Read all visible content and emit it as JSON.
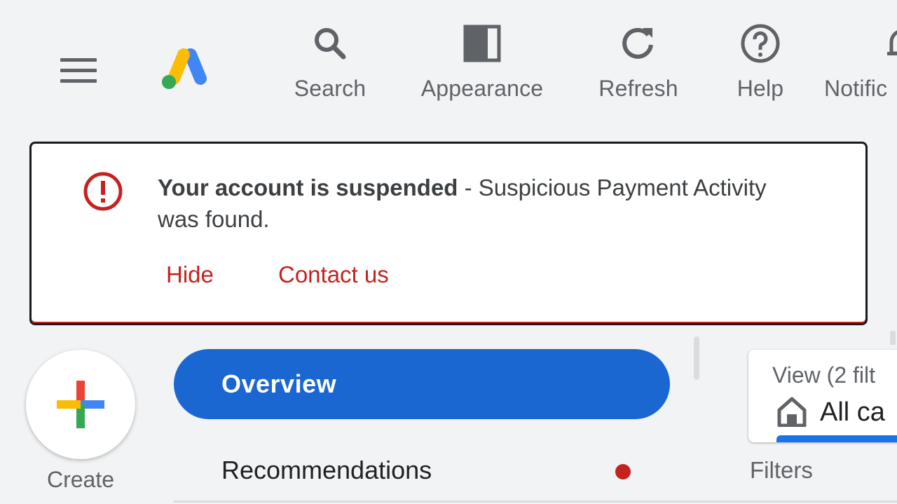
{
  "header": {
    "menu_icon": "hamburger-icon",
    "logo_icon": "google-ads-logo",
    "tools": [
      {
        "label": "Search",
        "icon": "search-icon"
      },
      {
        "label": "Appearance",
        "icon": "appearance-icon"
      },
      {
        "label": "Refresh",
        "icon": "refresh-icon"
      },
      {
        "label": "Help",
        "icon": "help-icon"
      },
      {
        "label": "Notific",
        "icon": "bell-icon"
      }
    ]
  },
  "alert": {
    "icon": "error-icon",
    "title": "Your account is suspended",
    "message": " - Suspicious Payment Activity was found.",
    "actions": {
      "hide": "Hide",
      "contact": "Contact us"
    },
    "accent_color": "#c5221f"
  },
  "create": {
    "label": "Create",
    "icon": "plus-icon"
  },
  "nav": {
    "overview": "Overview",
    "recommendations": "Recommendations",
    "active_color": "#1a67d2"
  },
  "view": {
    "label": "View (2 filt",
    "value": "All ca",
    "icon": "home-icon"
  },
  "filters": {
    "label": "Filters"
  }
}
